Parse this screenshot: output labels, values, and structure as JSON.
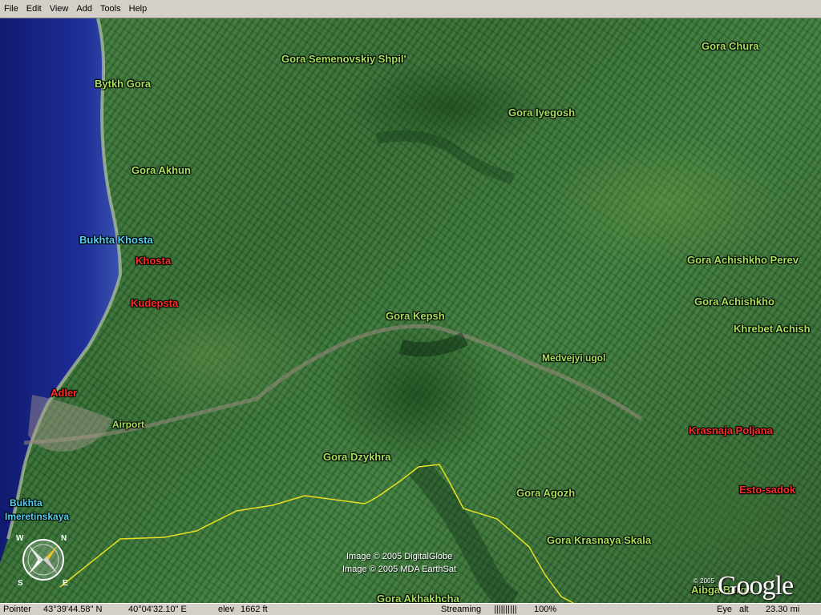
{
  "menu": [
    "File",
    "Edit",
    "View",
    "Add",
    "Tools",
    "Help"
  ],
  "map": {
    "labels": [
      {
        "text": "Gora Semenovskiy Shpil'",
        "color": "green"
      },
      {
        "text": "Gora Chura",
        "color": "green"
      },
      {
        "text": "Bytkh Gora",
        "color": "green"
      },
      {
        "text": "Gora Iyegosh",
        "color": "green"
      },
      {
        "text": "Gora Akhun",
        "color": "green"
      },
      {
        "text": "Bukhta Khosta",
        "color": "cyan"
      },
      {
        "text": "Khosta",
        "color": "red"
      },
      {
        "text": "Gora Achishkho Perev",
        "color": "green"
      },
      {
        "text": "Kudepsta",
        "color": "red"
      },
      {
        "text": "Gora Achishkho",
        "color": "green"
      },
      {
        "text": "Gora Kepsh",
        "color": "green"
      },
      {
        "text": "Khrebet Achish",
        "color": "green"
      },
      {
        "text": "Medvejyi ugol",
        "color": "green"
      },
      {
        "text": "Adler",
        "color": "red"
      },
      {
        "text": "Airport",
        "color": "green"
      },
      {
        "text": "Krasnaja Poljana",
        "color": "red"
      },
      {
        "text": "Gora Dzykhra",
        "color": "green"
      },
      {
        "text": "Gora Agozh",
        "color": "green"
      },
      {
        "text": "Esto-sadok",
        "color": "red"
      },
      {
        "text": "Bukhta",
        "color": "cyan"
      },
      {
        "text": "Imeretinskaya",
        "color": "cyan"
      },
      {
        "text": "Gora Krasnaya Skala",
        "color": "green"
      },
      {
        "text": "Aibga Berge",
        "color": "green"
      },
      {
        "text": "Gora Akhakhcha",
        "color": "green"
      }
    ],
    "credits": [
      "Image © 2005 DigitalGlobe",
      "Image © 2005 MDA EarthSat"
    ],
    "logo": {
      "year": "© 2005",
      "text": "Google"
    },
    "compass_letters": [
      "N",
      "E",
      "S",
      "W"
    ],
    "colors": {
      "water": "#1a2a8c",
      "label_green": "#a6e05a",
      "label_cyan": "#4fd2f0",
      "label_red": "#ff2a2a",
      "boundary_line": "#e8e020"
    }
  },
  "status": {
    "pointer_label": "Pointer",
    "latitude": "43°39'44.58\" N",
    "longitude": "40°04'32.10\" E",
    "elev_label": "elev",
    "elev_value": "1662 ft",
    "streaming_label": "Streaming",
    "streaming_bar": "||||||||||",
    "streaming_percent": "100%",
    "eye_label": "Eye",
    "alt_label": "alt",
    "alt_value": "23.30 mi"
  }
}
